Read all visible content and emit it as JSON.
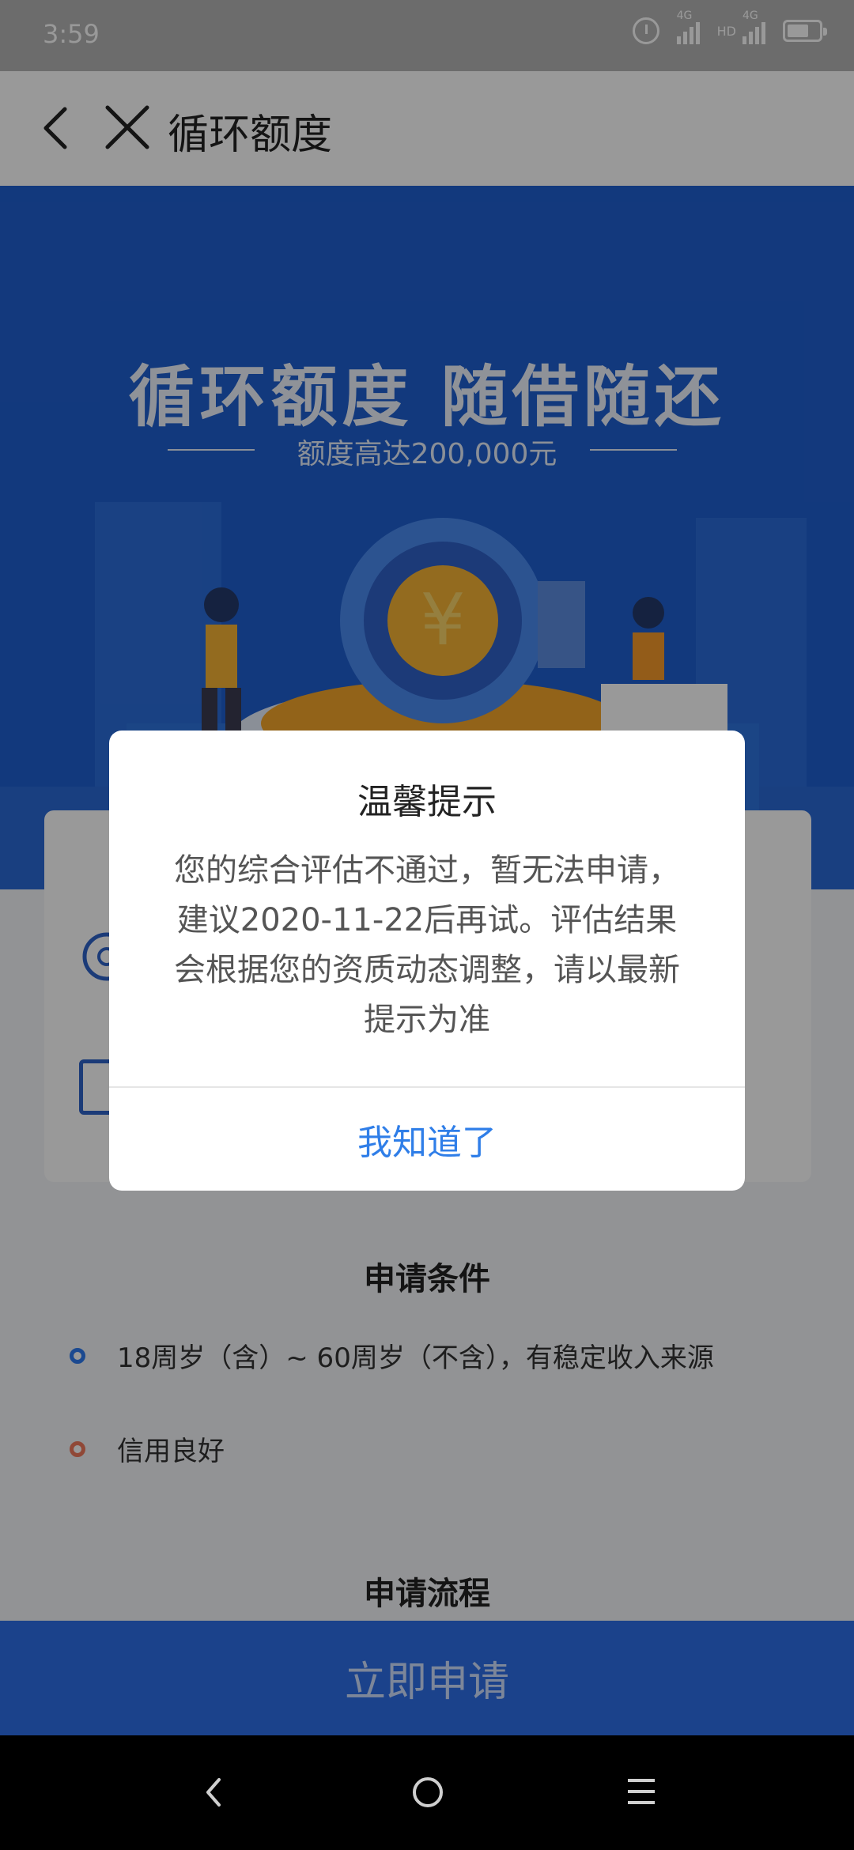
{
  "status_bar": {
    "time": "3:59",
    "network_1": "4G",
    "network_2": "4G",
    "hd_label": "HD",
    "icons": [
      "alarm-icon",
      "signal-icon",
      "signal-icon",
      "battery-icon"
    ]
  },
  "title_bar": {
    "title": "循环额度",
    "back_icon": "back-icon",
    "close_icon": "close-icon"
  },
  "banner": {
    "headline": "循环额度   随借随还",
    "subline": "额度高达200,000元"
  },
  "conditions": {
    "title": "申请条件",
    "items": [
      {
        "text": "18周岁（含）~ 60周岁（不含），有稳定收入来源",
        "dot_color": "#2e7bf0"
      },
      {
        "text": "信用良好",
        "dot_color": "#f0795c"
      }
    ]
  },
  "process": {
    "title": "申请流程"
  },
  "apply_button": {
    "label": "立即申请"
  },
  "dialog": {
    "title": "温馨提示",
    "body": "您的综合评估不通过，暂无法申请，建议2020-11-22后再试。评估结果会根据您的资质动态调整，请以最新提示为准",
    "button": "我知道了"
  },
  "colors": {
    "primary": "#2d6ee8",
    "banner": "#1f5fd0",
    "dialog_button": "#2f7ee8"
  }
}
